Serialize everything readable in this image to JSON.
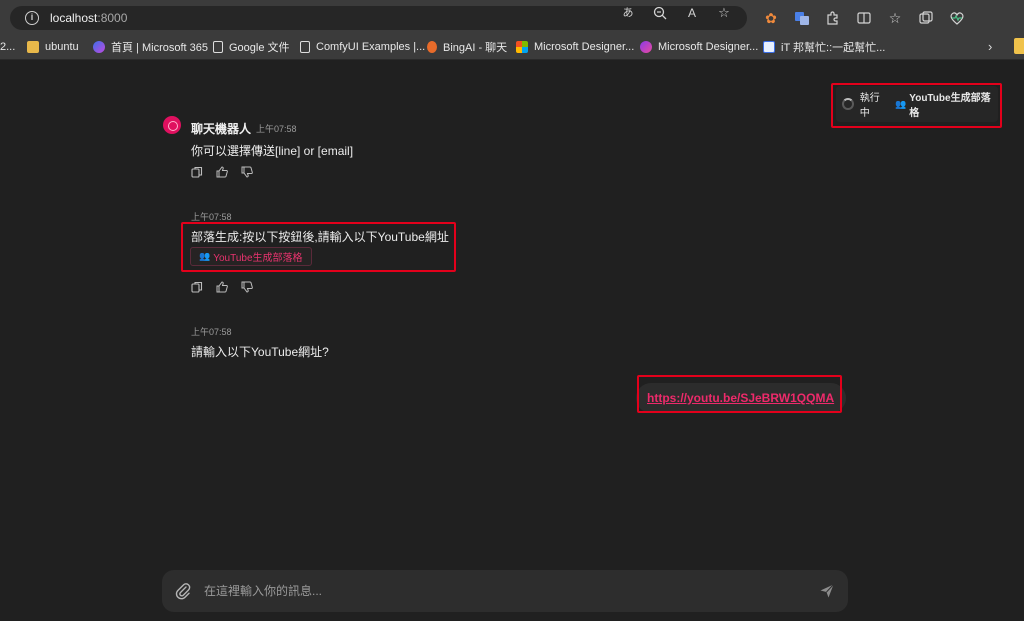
{
  "browser": {
    "url_host": "localhost",
    "url_port": ":8000",
    "bookmarks": [
      {
        "label": "2..."
      },
      {
        "label": "ubuntu"
      },
      {
        "label": "首頁 | Microsoft 365"
      },
      {
        "label": "Google 文件"
      },
      {
        "label": "ComfyUI Examples |..."
      },
      {
        "label": "BingAI - 聊天"
      },
      {
        "label": "Microsoft Designer..."
      },
      {
        "label": "Microsoft Designer..."
      },
      {
        "label": "iT 邦幫忙::一起幫忙..."
      }
    ]
  },
  "task": {
    "status": "執行中",
    "name": "YouTube生成部落格"
  },
  "messages": [
    {
      "author": "聊天機器人",
      "time": "上午07:58",
      "text": "你可以選擇傳送[line] or [email]"
    },
    {
      "time": "上午07:58",
      "text": "部落生成:按以下按鈕後,請輸入以下YouTube網址",
      "action_label": "YouTube生成部落格"
    },
    {
      "time": "上午07:58",
      "text": "請輸入以下YouTube網址?"
    }
  ],
  "user_message": {
    "text": "https://youtu.be/SJeBRW1QQMA"
  },
  "composer": {
    "placeholder": "在這裡輸入你的訊息..."
  },
  "colors": {
    "accent": "#e8336e",
    "highlight_box": "#e3001b",
    "background": "#202020"
  }
}
